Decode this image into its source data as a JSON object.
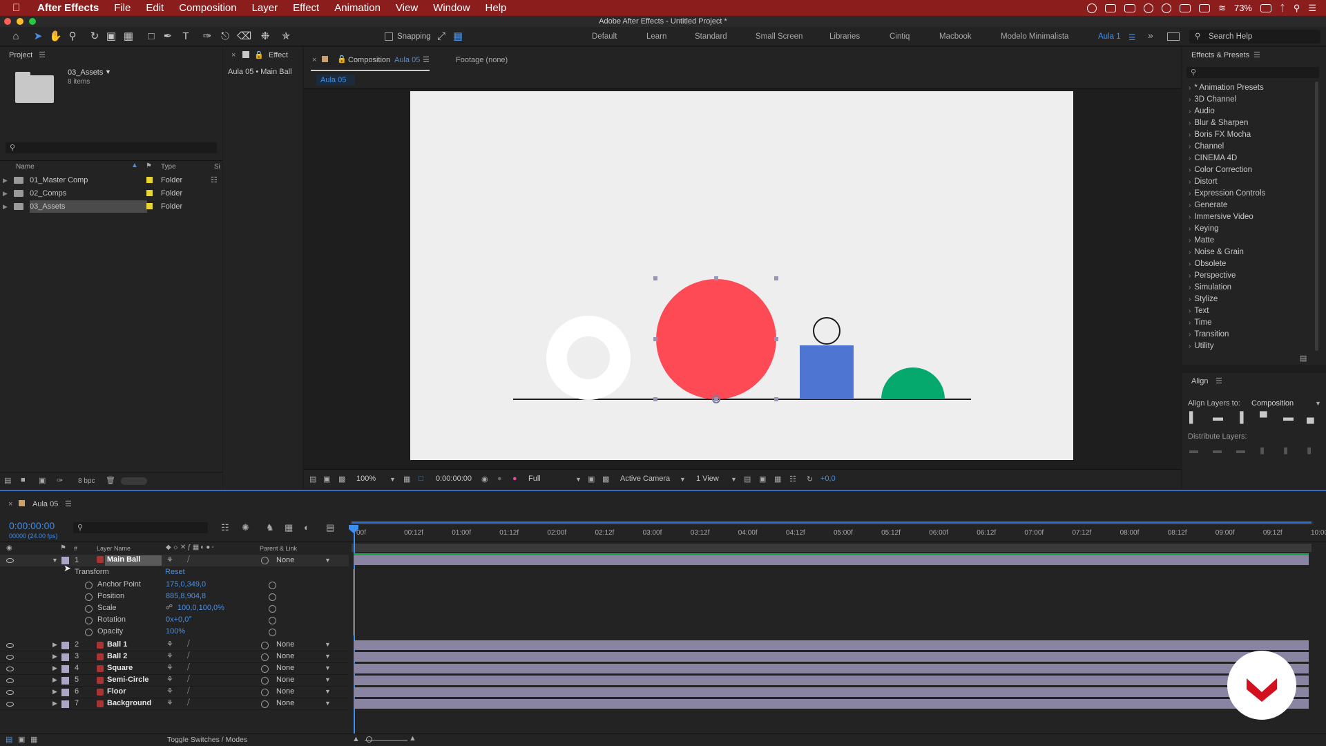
{
  "menubar": {
    "app": "After Effects",
    "items": [
      "File",
      "Edit",
      "Composition",
      "Layer",
      "Effect",
      "Animation",
      "View",
      "Window",
      "Help"
    ],
    "battery": "73%"
  },
  "window_title": "Adobe After Effects - Untitled Project *",
  "toolbar": {
    "snapping_label": "Snapping",
    "workspaces": [
      "Default",
      "Learn",
      "Standard",
      "Small Screen",
      "Libraries",
      "Cintiq",
      "Macbook",
      "Modelo Minimalista",
      "Aula 1"
    ],
    "active_workspace": "Aula 1",
    "search_help": "Search Help"
  },
  "project": {
    "title": "Project",
    "selected_name": "03_Assets",
    "selected_count": "8 items",
    "columns": {
      "name": "Name",
      "type": "Type",
      "size": "Si"
    },
    "items": [
      {
        "name": "01_Master Comp",
        "type": "Folder"
      },
      {
        "name": "02_Comps",
        "type": "Folder"
      },
      {
        "name": "03_Assets",
        "type": "Folder"
      }
    ],
    "bpc": "8 bpc"
  },
  "effect_controls": {
    "title": "Effect",
    "layer": "Aula 05 • Main Ball"
  },
  "composition": {
    "tab_prefix": "Composition",
    "tab_name": "Aula 05",
    "footage_tab": "Footage (none)",
    "sub_tab": "Aula 05",
    "zoom": "100%",
    "timecode": "0:00:00:00",
    "resolution": "Full",
    "camera": "Active Camera",
    "views": "1 View",
    "exposure": "+0,0"
  },
  "effects_presets": {
    "title": "Effects & Presets",
    "items": [
      "* Animation Presets",
      "3D Channel",
      "Audio",
      "Blur & Sharpen",
      "Boris FX Mocha",
      "Channel",
      "CINEMA 4D",
      "Color Correction",
      "Distort",
      "Expression Controls",
      "Generate",
      "Immersive Video",
      "Keying",
      "Matte",
      "Noise & Grain",
      "Obsolete",
      "Perspective",
      "Simulation",
      "Stylize",
      "Text",
      "Time",
      "Transition",
      "Utility"
    ]
  },
  "align": {
    "title": "Align",
    "align_to_label": "Align Layers to:",
    "align_to_value": "Composition",
    "distribute_label": "Distribute Layers:"
  },
  "timeline": {
    "title": "Aula 05",
    "timecode": "0:00:00:00",
    "frame_info": "00000 (24.00 fps)",
    "col_layer_name": "Layer Name",
    "col_parent": "Parent & Link",
    "col_hash": "#",
    "ticks": [
      "00f",
      "00:12f",
      "01:00f",
      "01:12f",
      "02:00f",
      "02:12f",
      "03:00f",
      "03:12f",
      "04:00f",
      "04:12f",
      "05:00f",
      "05:12f",
      "06:00f",
      "06:12f",
      "07:00f",
      "07:12f",
      "08:00f",
      "08:12f",
      "09:00f",
      "09:12f",
      "10:00"
    ],
    "transform_label": "Transform",
    "reset_label": "Reset",
    "properties": [
      {
        "name": "Anchor Point",
        "value": "175,0,349,0"
      },
      {
        "name": "Position",
        "value": "885,8,904,8"
      },
      {
        "name": "Scale",
        "value": "100,0,100,0%"
      },
      {
        "name": "Rotation",
        "value": "0x+0,0°"
      },
      {
        "name": "Opacity",
        "value": "100%"
      }
    ],
    "layers": [
      {
        "num": "1",
        "name": "Main Ball",
        "parent": "None"
      },
      {
        "num": "2",
        "name": "Ball 1",
        "parent": "None"
      },
      {
        "num": "3",
        "name": "Ball 2",
        "parent": "None"
      },
      {
        "num": "4",
        "name": "Square",
        "parent": "None"
      },
      {
        "num": "5",
        "name": "Semi-Circle",
        "parent": "None"
      },
      {
        "num": "6",
        "name": "Floor",
        "parent": "None"
      },
      {
        "num": "7",
        "name": "Background",
        "parent": "None"
      }
    ],
    "toggle_label": "Toggle Switches / Modes"
  },
  "colors": {
    "menubar": "#8b1d1d",
    "accent": "#3b8ff0",
    "main_ball": "#fd4a55",
    "square": "#4f75d3",
    "semi_circle": "#05a86d",
    "layer_bar": "#8a84a3"
  }
}
